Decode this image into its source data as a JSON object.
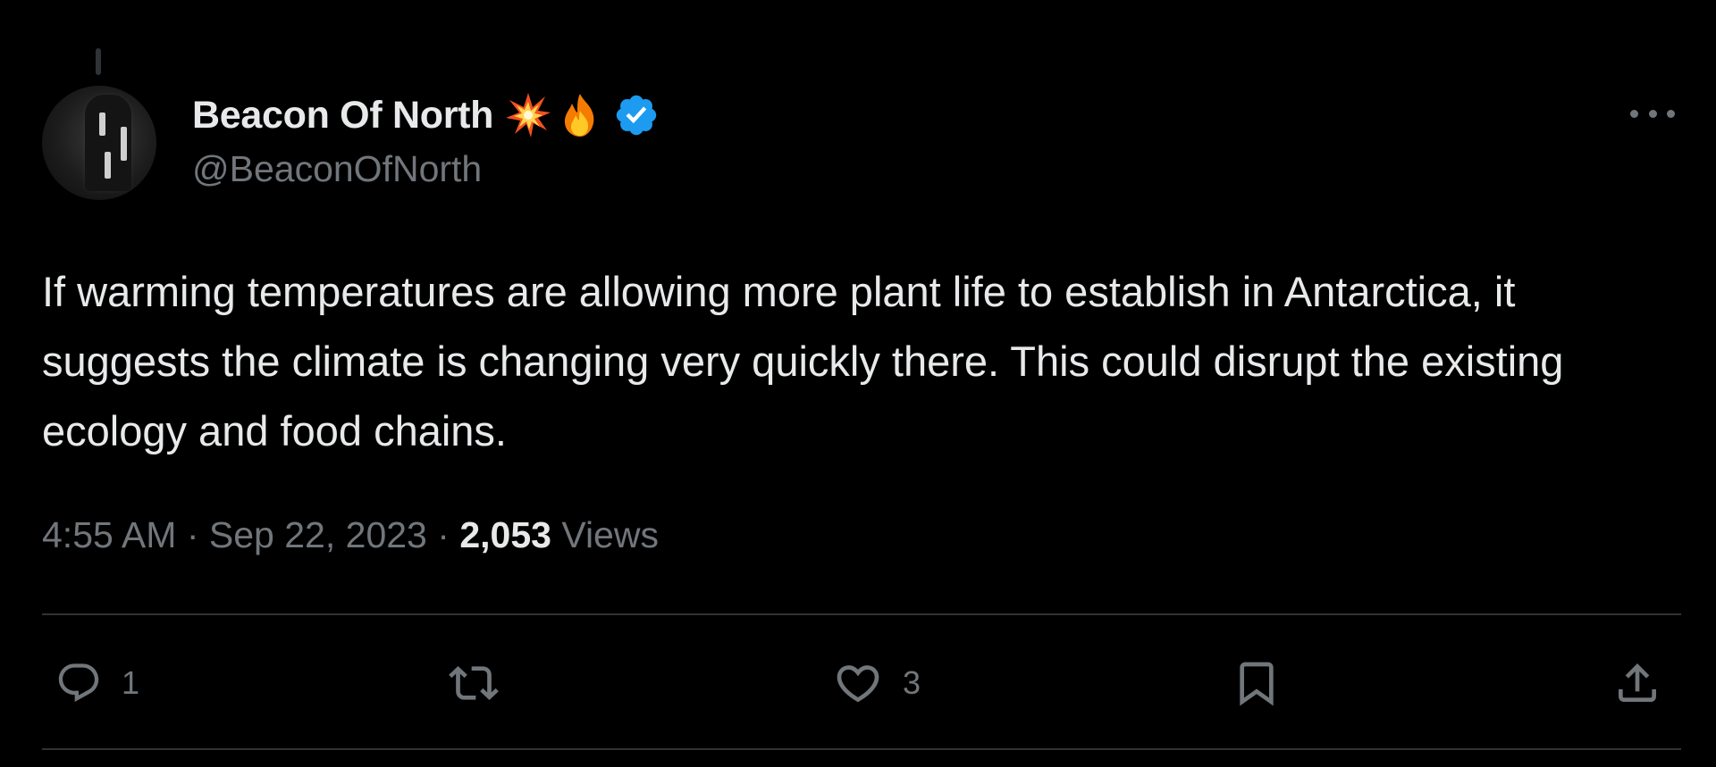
{
  "author": {
    "display_name": "Beacon Of North",
    "handle": "@BeaconOfNorth",
    "badges": [
      "collision-emoji",
      "fire-emoji",
      "verified-badge-icon"
    ],
    "verified_color": "#1d9bf0"
  },
  "tweet": {
    "text": "If warming temperatures are allowing more plant life to establish in Antarctica, it suggests the climate is changing very quickly there. This could disrupt the existing ecology and food chains."
  },
  "meta": {
    "time": "4:55 AM",
    "separator": "·",
    "date": "Sep 22, 2023",
    "views_count": "2,053",
    "views_label": "Views"
  },
  "actions": {
    "reply": {
      "icon": "reply-icon",
      "count": "1"
    },
    "retweet": {
      "icon": "retweet-icon",
      "count": ""
    },
    "like": {
      "icon": "heart-icon",
      "count": "3"
    },
    "bookmark": {
      "icon": "bookmark-icon"
    },
    "share": {
      "icon": "share-icon"
    }
  },
  "colors": {
    "background": "#000000",
    "text_primary": "#e7e9ea",
    "text_secondary": "#71767b",
    "divider": "#2f3336"
  }
}
